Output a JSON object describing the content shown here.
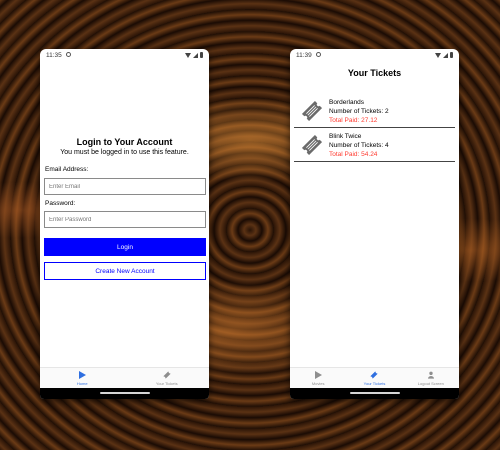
{
  "login_screen": {
    "status_time": "11:35",
    "title": "Login to Your Account",
    "subtitle": "You must be logged in to use this feature.",
    "email_label": "Email Address:",
    "email_placeholder": "Enter Email",
    "email_value": "",
    "password_label": "Password:",
    "password_placeholder": "Enter Password",
    "password_value": "",
    "login_button": "Login",
    "create_account_button": "Create New Account",
    "tabs": [
      {
        "label": "Home",
        "icon": "play-icon",
        "active": true
      },
      {
        "label": "Your Tickets",
        "icon": "ticket-icon",
        "active": false
      }
    ]
  },
  "tickets_screen": {
    "status_time": "11:39",
    "title": "Your Tickets",
    "tickets": [
      {
        "name": "Borderlands",
        "count_text": "Number of Tickets: 2",
        "total_text": "Total Paid: 27.12"
      },
      {
        "name": "Blink Twice",
        "count_text": "Number of Tickets: 4",
        "total_text": "Total Paid: 54.24"
      }
    ],
    "tabs": [
      {
        "label": "Movies",
        "icon": "play-icon",
        "active": false
      },
      {
        "label": "Your Tickets",
        "icon": "ticket-icon",
        "active": true
      },
      {
        "label": "Logout Screen",
        "icon": "user-icon",
        "active": false
      }
    ]
  },
  "colors": {
    "primary_button": "#0000ff",
    "active_tab": "#2f6fe0",
    "total_paid": "#ff3b30",
    "inactive_tab": "#8e8e8e"
  }
}
